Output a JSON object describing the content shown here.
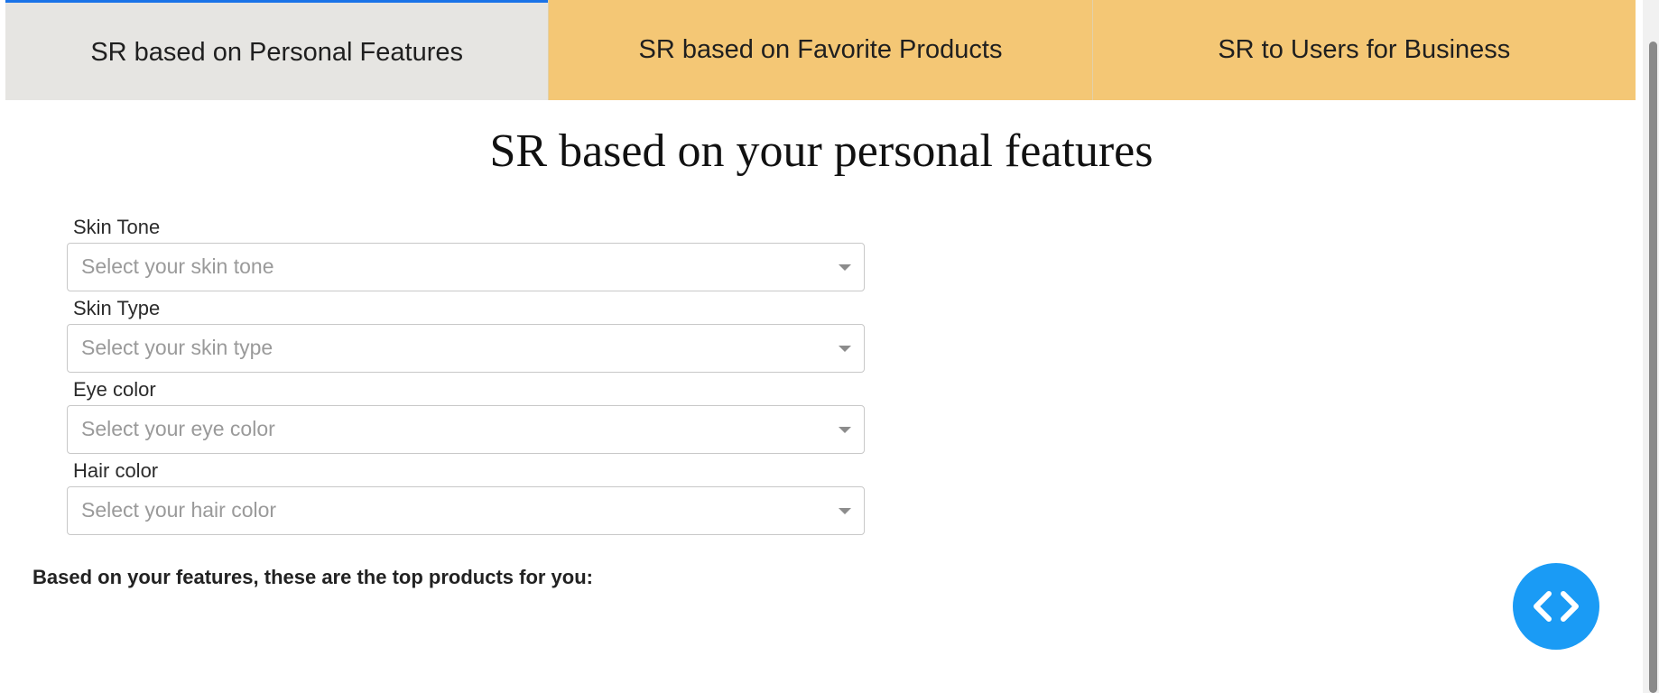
{
  "tabs": [
    {
      "label": "SR based on Personal Features",
      "active": true
    },
    {
      "label": "SR based on Favorite Products",
      "active": false
    },
    {
      "label": "SR to Users for Business",
      "active": false
    }
  ],
  "page_title": "SR based on your personal features",
  "form": {
    "fields": [
      {
        "label": "Skin Tone",
        "placeholder": "Select your skin tone"
      },
      {
        "label": "Skin Type",
        "placeholder": "Select your skin type"
      },
      {
        "label": "Eye color",
        "placeholder": "Select your eye color"
      },
      {
        "label": "Hair color",
        "placeholder": "Select your hair color"
      }
    ]
  },
  "results": {
    "heading": "Based on your features, these are the top products for you:"
  },
  "fab": {
    "icon": "code-icon"
  },
  "colors": {
    "tab_active_bg": "#e6e5e2",
    "tab_inactive_bg": "#f4c775",
    "tab_active_border": "#1a73e8",
    "fab_bg": "#1a9bf5"
  }
}
